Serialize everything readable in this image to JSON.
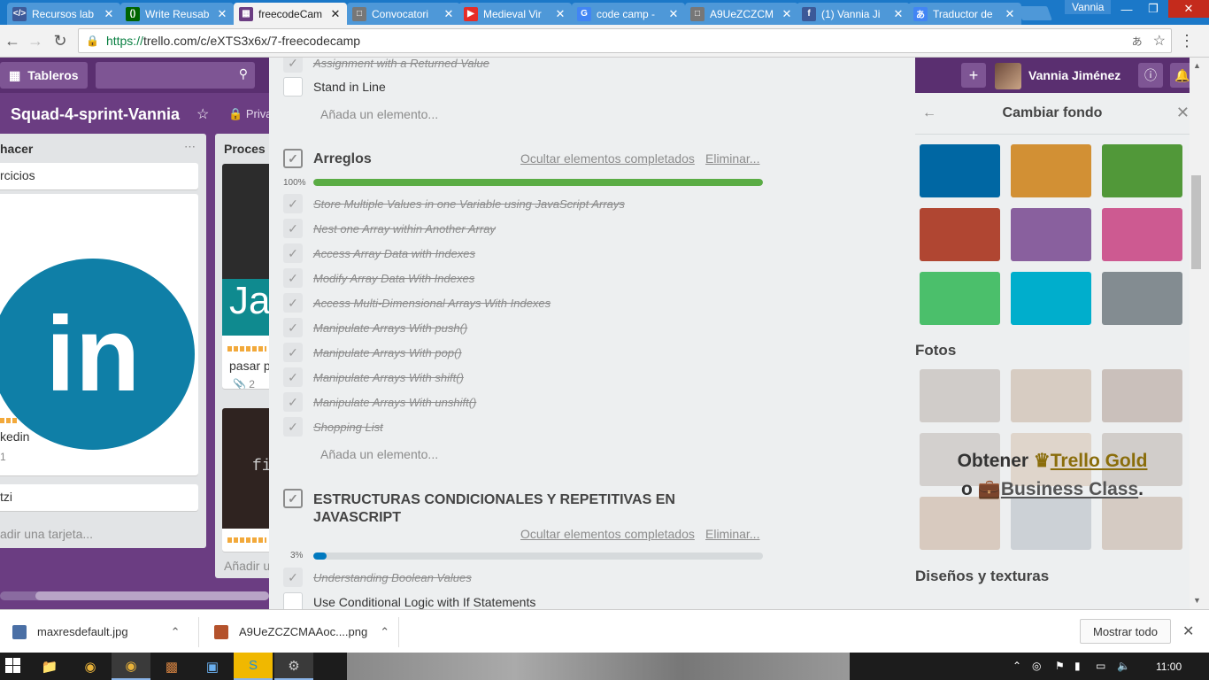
{
  "browser": {
    "tabs": [
      {
        "title": "Recursos lab",
        "icon": "code-icon",
        "color": "#3d5a99"
      },
      {
        "title": "Write Reusab",
        "icon": "fcc-icon",
        "color": "#006400"
      },
      {
        "title": "freecodeCam",
        "icon": "trello-icon",
        "color": "#6b3d82",
        "active": true
      },
      {
        "title": "Convocatori",
        "icon": "doc-icon",
        "color": "#777777"
      },
      {
        "title": "Medieval Vir",
        "icon": "youtube-icon",
        "color": "#e52d27"
      },
      {
        "title": "code camp -",
        "icon": "google-icon",
        "color": "#4285f4"
      },
      {
        "title": "A9UeZCZCM",
        "icon": "doc-icon",
        "color": "#777777"
      },
      {
        "title": "(1) Vannia Ji",
        "icon": "facebook-icon",
        "color": "#3b5998"
      },
      {
        "title": "Traductor de",
        "icon": "translate-icon",
        "color": "#4285f4"
      }
    ],
    "profile": "Vannia",
    "url_proto": "https://",
    "url_rest": "trello.com/c/eXTS3x6x/7-freecodecamp"
  },
  "board": {
    "tableros_label": "Tableros",
    "title": "Squad-4-sprint-Vannia",
    "privacy": "Priva",
    "user_name": "Vannia Jiménez",
    "list1": {
      "title": "hacer",
      "card1": "rcicios",
      "logo_text": "in",
      "card_label": "kedin",
      "card_count": "1",
      "card3": "tzi",
      "add_card": "adir una tarjeta..."
    },
    "list2": {
      "title": "Proces",
      "card_text": "pasar p",
      "attach_count": "2",
      "code_text": "fi",
      "add_card": "Añadir u"
    }
  },
  "sidebar": {
    "title": "Cambiar fondo",
    "colors": [
      "#0067a3",
      "#d29034",
      "#519839",
      "#b04632",
      "#89609e",
      "#cd5a91",
      "#4bbf6b",
      "#00aecc",
      "#838c91"
    ],
    "photos_heading": "Fotos",
    "promo_obtener": "Obtener",
    "promo_gold": "Trello Gold",
    "promo_o": "o",
    "promo_business": "Business Class",
    "promo_period": ".",
    "patterns_heading": "Diseños y texturas"
  },
  "checklist": {
    "top_item": "Assignment with a Returned Value",
    "top_open_item": "Stand in Line",
    "add_item": "Añada un elemento...",
    "arreglos": {
      "title": "Arreglos",
      "hide_label": "Ocultar elementos completados",
      "delete_label": "Eliminar...",
      "percent_label": "100%",
      "percent": 100,
      "color": "#5aac44",
      "items": [
        "Store Multiple Values in one Variable using JavaScript Arrays",
        "Nest one Array within Another Array",
        "Access Array Data with Indexes",
        "Modify Array Data With Indexes",
        "Access Multi-Dimensional Arrays With Indexes",
        "Manipulate Arrays With push()",
        "Manipulate Arrays With pop()",
        "Manipulate Arrays With shift()",
        "Manipulate Arrays With unshift()",
        "Shopping List"
      ],
      "add_item": "Añada un elemento..."
    },
    "estructuras": {
      "title_line1": "ESTRUCTURAS CONDICIONALES Y REPETITIVAS EN",
      "title_line2": "JAVASCRIPT",
      "hide_label": "Ocultar elementos completados",
      "delete_label": "Eliminar...",
      "percent_label": "3%",
      "percent": 3,
      "color": "#0079bf",
      "done_item": "Understanding Boolean Values",
      "open_item": "Use Conditional Logic with If Statements"
    }
  },
  "downloads": {
    "file1": "maxresdefault.jpg",
    "file2": "A9UeZCZCMAAoc....png",
    "show_all": "Mostrar todo"
  },
  "taskbar": {
    "clock": "11:00"
  }
}
